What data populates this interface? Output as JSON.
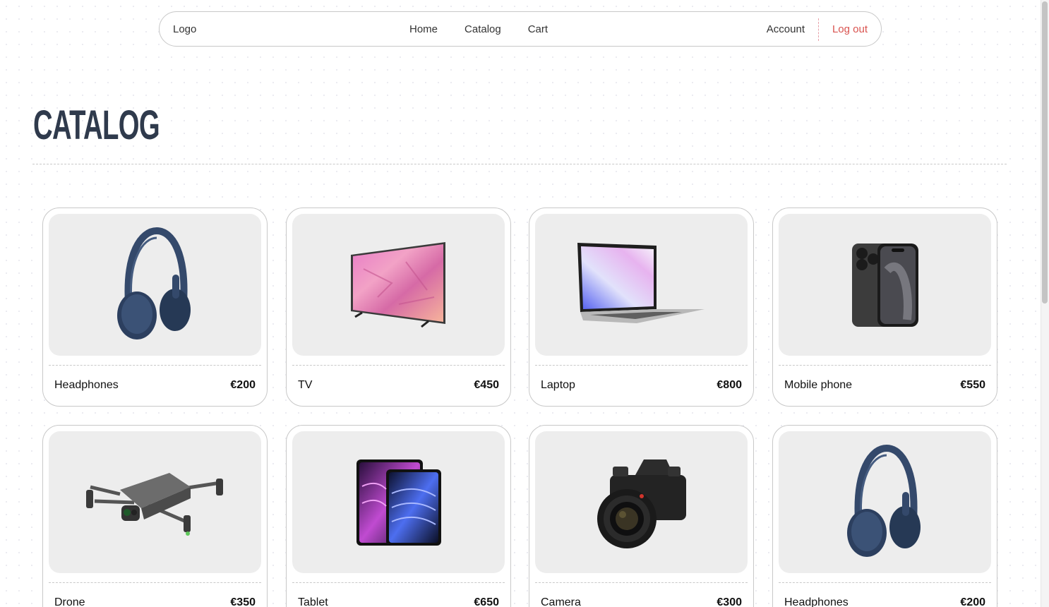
{
  "nav": {
    "logo": "Logo",
    "links": [
      "Home",
      "Catalog",
      "Cart"
    ],
    "account": "Account",
    "logout": "Log out"
  },
  "page": {
    "title": "CATALOG"
  },
  "products": [
    {
      "name": "Headphones",
      "price": "€200",
      "icon": "headphones-image"
    },
    {
      "name": "TV",
      "price": "€450",
      "icon": "tv-image"
    },
    {
      "name": "Laptop",
      "price": "€800",
      "icon": "laptop-image"
    },
    {
      "name": "Mobile phone",
      "price": "€550",
      "icon": "mobile-phone-image"
    },
    {
      "name": "Drone",
      "price": "€350",
      "icon": "drone-image"
    },
    {
      "name": "Tablet",
      "price": "€650",
      "icon": "tablet-image"
    },
    {
      "name": "Camera",
      "price": "€300",
      "icon": "camera-image"
    },
    {
      "name": "Headphones",
      "price": "€200",
      "icon": "headphones-image"
    }
  ],
  "colors": {
    "title": "#2f3a4c",
    "logout": "#d9534f",
    "card_image_bg": "#ededed",
    "border": "#c8c8c8"
  }
}
